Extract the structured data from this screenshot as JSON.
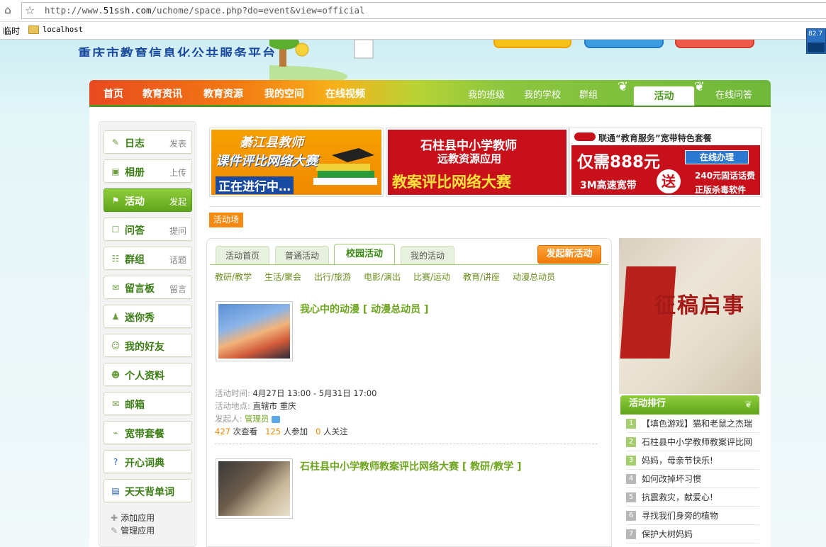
{
  "browser": {
    "url_prefix": "http://www.",
    "url_domain": "51ssh.com",
    "url_path": "/uchome/space.php?do=event&view=official",
    "bookmark_label": "临时",
    "bookmark_item": "localhost",
    "widget_value": "82.7"
  },
  "site": {
    "logo_text": "重庆市教育信息化公共服务平台"
  },
  "topnav": {
    "left": [
      "首页",
      "教育资讯",
      "教育资源",
      "我的空间",
      "在线视频"
    ],
    "right": [
      "我的班级",
      "我的学校",
      "群组"
    ],
    "active": "活动",
    "last": "在线问答"
  },
  "sidebar": {
    "items": [
      {
        "label": "日志",
        "action": "发表",
        "icon": "pencil-icon"
      },
      {
        "label": "相册",
        "action": "上传",
        "icon": "photo-icon"
      },
      {
        "label": "活动",
        "action": "发起",
        "icon": "flag-icon"
      },
      {
        "label": "问答",
        "action": "提问",
        "icon": "question-icon"
      },
      {
        "label": "群组",
        "action": "话题",
        "icon": "group-icon"
      },
      {
        "label": "留言板",
        "action": "留言",
        "icon": "message-icon"
      },
      {
        "label": "迷你秀",
        "action": "",
        "icon": "show-icon"
      },
      {
        "label": "我的好友",
        "action": "",
        "icon": "friends-icon"
      },
      {
        "label": "个人资料",
        "action": "",
        "icon": "profile-icon"
      },
      {
        "label": "邮箱",
        "action": "",
        "icon": "mail-icon"
      },
      {
        "label": "宽带套餐",
        "action": "",
        "icon": "broadband-icon"
      },
      {
        "label": "开心词典",
        "action": "",
        "icon": "help-icon"
      },
      {
        "label": "天天背单词",
        "action": "",
        "icon": "book-icon"
      }
    ],
    "add_app": "添加应用",
    "manage_app": "管理应用"
  },
  "banners": {
    "b1_line1": "綦江县教师",
    "b1_line2": "课件评比网络大赛",
    "b1_line3": "正在进行中…",
    "b2_line1": "石柱县中小学教师",
    "b2_line2": "远教资源应用",
    "b2_line3": "教案评比网络大赛",
    "b3_title": "联通“教育服务”宽带特色套餐",
    "b3_price": "仅需888元",
    "b3_btn": "在线办理",
    "b3_speed": "3M高速宽带",
    "b3_send": "送",
    "b3_gift1": "240元固话话费",
    "b3_gift2": "正版杀毒软件"
  },
  "section_tag": "活动场",
  "tabs": [
    "活动首页",
    "普通活动",
    "校园活动",
    "我的活动"
  ],
  "new_event_button": "发起新活动",
  "subcats": [
    "教研/教学",
    "生活/聚会",
    "出行/旅游",
    "电影/演出",
    "比赛/运动",
    "教育/讲座",
    "动漫总动员"
  ],
  "events": [
    {
      "title": "我心中的动漫 [ 动漫总动员 ]",
      "time_label": "活动时间:",
      "time": "4月27日 13:00 - 5月31日 17:00",
      "place_label": "活动地点:",
      "place": "直辖市 重庆",
      "host_label": "发起人:",
      "host": "管理员",
      "views": "427",
      "views_label": "次查看",
      "joins": "125",
      "joins_label": "人参加",
      "follows": "0",
      "follows_label": "人关注"
    },
    {
      "title": "石柱县中小学教师教案评比网络大赛 [ 教研/教学 ]"
    }
  ],
  "right_image_text": "征稿启事",
  "ranking": {
    "title": "活动排行",
    "items": [
      "【填色游戏】猫和老鼠之杰瑞",
      "石柱县中小学教师教案评比网",
      "妈妈，母亲节快乐!",
      "如何改掉坏习惯",
      "抗震救灾，献爱心!",
      "寻找我们身旁的植物",
      "保护大树妈妈"
    ]
  },
  "colors": {
    "accent_green": "#6ea51e",
    "accent_orange": "#f08a00"
  }
}
